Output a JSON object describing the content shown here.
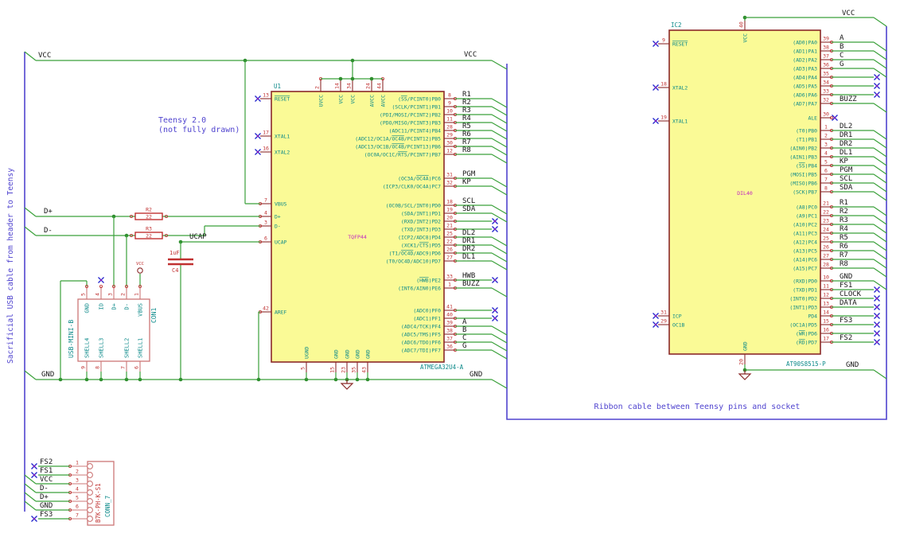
{
  "notes": {
    "sacrificial_cable": "Sacrificial USB cable from header to Teensy",
    "teensy_title": "Teensy 2.0",
    "teensy_subtitle": "(not fully drawn)",
    "ribbon_cable": "Ribbon cable between Teensy pins and socket"
  },
  "power": {
    "vcc": "VCC",
    "gnd": "GND",
    "d_plus": "D+",
    "d_minus": "D-",
    "ucap": "UCAP",
    "vcc_symbol": "VCC"
  },
  "u1": {
    "ref": "U1",
    "value": "ATMEGA32U4-A",
    "footprint": "TQFP44",
    "left_pins": [
      {
        "num": "13",
        "name": "~RESET~",
        "term": "x"
      },
      {
        "num": "17",
        "name": "XTAL1",
        "term": "x"
      },
      {
        "num": "16",
        "name": "XTAL2",
        "term": "x"
      },
      {
        "num": "7",
        "name": "VBUS",
        "term": "wire"
      },
      {
        "num": "4",
        "name": "D+",
        "term": "wire"
      },
      {
        "num": "3",
        "name": "D-",
        "term": "wire"
      },
      {
        "num": "6",
        "name": "UCAP",
        "term": "wire"
      },
      {
        "num": "42",
        "name": "AREF",
        "term": "wire"
      }
    ],
    "right_pins": [
      {
        "num": "8",
        "name": "(~SS~/PCINT0)PB0",
        "label": "R1",
        "term": "bus"
      },
      {
        "num": "9",
        "name": "(SCLK/PCINT1)PB1",
        "label": "R2",
        "term": "bus"
      },
      {
        "num": "10",
        "name": "(PDI/MOSI/PCINT2)PB2",
        "label": "R3",
        "term": "bus"
      },
      {
        "num": "11",
        "name": "(PDO/MISO/PCINT3)PB3",
        "label": "R4",
        "term": "bus"
      },
      {
        "num": "28",
        "name": "(ADC11/PCINT4)PB4",
        "label": "R5",
        "term": "bus"
      },
      {
        "num": "29",
        "name": "(ADC12/OC1A/~OC4B~/PCINT12)PB5",
        "label": "R6",
        "term": "bus"
      },
      {
        "num": "30",
        "name": "(ADC13/OC1B/~OC4B~/PCINT13)PB6",
        "label": "R7",
        "term": "bus"
      },
      {
        "num": "12",
        "name": "(OC0A/OC1C/~RTS~/PCINT7)PB7",
        "label": "R8",
        "term": "bus"
      },
      {
        "num": "31",
        "name": "(OC3A/~OC4A~)PC6",
        "label": "PGM",
        "term": "bus"
      },
      {
        "num": "32",
        "name": "(ICP3/CLK0/OC4A)PC7",
        "label": "KP",
        "term": "bus"
      },
      {
        "num": "18",
        "name": "(OC0B/SCL/INT0)PD0",
        "label": "SCL",
        "term": "bus"
      },
      {
        "num": "19",
        "name": "(SDA/INT1)PD1",
        "label": "SDA",
        "term": "bus"
      },
      {
        "num": "20",
        "name": "(RXD/INT2)PD2",
        "label": "",
        "term": "x"
      },
      {
        "num": "21",
        "name": "(TXD/INT3)PD3",
        "label": "",
        "term": "x"
      },
      {
        "num": "25",
        "name": "(ICP2/ADC8)PD4",
        "label": "DL2",
        "term": "bus"
      },
      {
        "num": "22",
        "name": "(XCK1/~CTS~)PD5",
        "label": "DR1",
        "term": "bus"
      },
      {
        "num": "26",
        "name": "(T1/~OC4D~/ADC9)PD6",
        "label": "DR2",
        "term": "bus"
      },
      {
        "num": "27",
        "name": "(T0/OC4D/ADC10)PD7",
        "label": "DL1",
        "term": "bus"
      },
      {
        "num": "33",
        "name": "(~HWB~)PE2",
        "label": "HWB",
        "term": "x"
      },
      {
        "num": "1",
        "name": "(INT6/AIN0)PE6",
        "label": "BUZZ",
        "term": "bus"
      },
      {
        "num": "41",
        "name": "(ADC0)PF0",
        "label": "",
        "term": "x"
      },
      {
        "num": "40",
        "name": "(ADC1)PF1",
        "label": "",
        "term": "x"
      },
      {
        "num": "39",
        "name": "(ADC4/TCK)PF4",
        "label": "A",
        "term": "bus"
      },
      {
        "num": "38",
        "name": "(ADC5/TMS)PF5",
        "label": "B",
        "term": "bus"
      },
      {
        "num": "37",
        "name": "(ADC6/TDO)PF6",
        "label": "C",
        "term": "bus"
      },
      {
        "num": "36",
        "name": "(ADC7/TDI)PF7",
        "label": "G",
        "term": "bus"
      }
    ],
    "top_pins": [
      {
        "num": "2",
        "name": "UVCC"
      },
      {
        "num": "14",
        "name": "VCC"
      },
      {
        "num": "34",
        "name": "VCC"
      },
      {
        "num": "24",
        "name": "AVCC"
      },
      {
        "num": "44",
        "name": "AVCC"
      }
    ],
    "bottom_pins": [
      {
        "num": "5",
        "name": "UGND"
      },
      {
        "num": "15",
        "name": "GND"
      },
      {
        "num": "23",
        "name": "GND"
      },
      {
        "num": "35",
        "name": "GND"
      },
      {
        "num": "43",
        "name": "GND"
      }
    ]
  },
  "ic2": {
    "ref": "IC2",
    "value": "AT90S8515-P",
    "footprint": "DIL40",
    "left_pins": [
      {
        "num": "9",
        "name": "~RESET~",
        "term": "x"
      },
      {
        "num": "18",
        "name": "XTAL2",
        "term": "x"
      },
      {
        "num": "19",
        "name": "XTAL1",
        "term": "x"
      },
      {
        "num": "31",
        "name": "ICP",
        "term": "x"
      },
      {
        "num": "29",
        "name": "OC1B",
        "term": "x"
      }
    ],
    "right_pins": [
      {
        "num": "39",
        "name": "(AD0)PA0",
        "label": "A",
        "term": "bus"
      },
      {
        "num": "38",
        "name": "(AD1)PA1",
        "label": "B",
        "term": "bus"
      },
      {
        "num": "37",
        "name": "(AD2)PA2",
        "label": "C",
        "term": "bus"
      },
      {
        "num": "36",
        "name": "(AD3)PA3",
        "label": "G",
        "term": "bus"
      },
      {
        "num": "35",
        "name": "(AD4)PA4",
        "label": "",
        "term": "x"
      },
      {
        "num": "34",
        "name": "(AD5)PA5",
        "label": "",
        "term": "x"
      },
      {
        "num": "33",
        "name": "(AD6)PA6",
        "label": "",
        "term": "x"
      },
      {
        "num": "32",
        "name": "(AD7)PA7",
        "label": "BUZZ",
        "term": "bus"
      },
      {
        "num": "30",
        "name": "ALE",
        "label": "",
        "term": "x_stub"
      },
      {
        "num": "1",
        "name": "(T0)PB0",
        "label": "DL2",
        "term": "bus"
      },
      {
        "num": "2",
        "name": "(T1)PB1",
        "label": "DR1",
        "term": "bus"
      },
      {
        "num": "3",
        "name": "(AIN0)PB2",
        "label": "DR2",
        "term": "bus"
      },
      {
        "num": "4",
        "name": "(AIN1)PB3",
        "label": "DL1",
        "term": "bus"
      },
      {
        "num": "5",
        "name": "(~SS~)PB4",
        "label": "KP",
        "term": "bus"
      },
      {
        "num": "6",
        "name": "(MOSI)PB5",
        "label": "PGM",
        "term": "bus"
      },
      {
        "num": "7",
        "name": "(MISO)PB6",
        "label": "SCL",
        "term": "bus"
      },
      {
        "num": "8",
        "name": "(SCK)PB7",
        "label": "SDA",
        "term": "bus"
      },
      {
        "num": "21",
        "name": "(A8)PC0",
        "label": "R1",
        "term": "bus"
      },
      {
        "num": "22",
        "name": "(A9)PC1",
        "label": "R2",
        "term": "bus"
      },
      {
        "num": "23",
        "name": "(A10)PC2",
        "label": "R3",
        "term": "bus"
      },
      {
        "num": "24",
        "name": "(A11)PC3",
        "label": "R4",
        "term": "bus"
      },
      {
        "num": "25",
        "name": "(A12)PC4",
        "label": "R5",
        "term": "bus"
      },
      {
        "num": "26",
        "name": "(A13)PC5",
        "label": "R6",
        "term": "bus"
      },
      {
        "num": "27",
        "name": "(A14)PC6",
        "label": "R7",
        "term": "bus"
      },
      {
        "num": "28",
        "name": "(A15)PC7",
        "label": "R8",
        "term": "bus"
      },
      {
        "num": "10",
        "name": "(RXD)PD0",
        "label": "GND",
        "term": "bus"
      },
      {
        "num": "11",
        "name": "(TXD)PD1",
        "label": "FS1",
        "term": "x"
      },
      {
        "num": "12",
        "name": "(INT0)PD2",
        "label": "CLOCK",
        "term": "x"
      },
      {
        "num": "13",
        "name": "(INT1)PD3",
        "label": "DATA",
        "term": "x"
      },
      {
        "num": "14",
        "name": "PD4",
        "label": "",
        "term": "x"
      },
      {
        "num": "15",
        "name": "(OC1A)PD5",
        "label": "FS3",
        "term": "x"
      },
      {
        "num": "16",
        "name": "(~WR~)PD6",
        "label": "",
        "term": "x"
      },
      {
        "num": "17",
        "name": "(~RD~)PD7",
        "label": "FS2",
        "term": "x"
      }
    ],
    "top_pins": [
      {
        "num": "40",
        "name": "VCC"
      }
    ],
    "bottom_pins": [
      {
        "num": "20",
        "name": "GND"
      }
    ]
  },
  "con1": {
    "ref": "CON1",
    "value": "USB-MINI-B",
    "top_pins": [
      {
        "num": "5",
        "name": "GND"
      },
      {
        "num": "4",
        "name": "ID"
      },
      {
        "num": "3",
        "name": "D+"
      },
      {
        "num": "2",
        "name": "D-"
      },
      {
        "num": "1",
        "name": "VBUS"
      }
    ],
    "bottom_pins": [
      {
        "num": "9",
        "name": "SHELL4"
      },
      {
        "num": "8",
        "name": "SHELL3"
      },
      {
        "num": "7",
        "name": "SHELL2"
      },
      {
        "num": "6",
        "name": "SHELL1"
      }
    ]
  },
  "conn7": {
    "ref": "CONN_7",
    "value": "B7K-PH-K-S1",
    "pins": [
      {
        "num": "1",
        "label": "FS2",
        "term": "x"
      },
      {
        "num": "2",
        "label": "FS1",
        "term": "x"
      },
      {
        "num": "3",
        "label": "VCC",
        "term": "bus"
      },
      {
        "num": "4",
        "label": "D-",
        "term": "bus"
      },
      {
        "num": "5",
        "label": "D+",
        "term": "bus"
      },
      {
        "num": "6",
        "label": "GND",
        "term": "bus"
      },
      {
        "num": "7",
        "label": "FS3",
        "term": "x"
      }
    ]
  },
  "r2": {
    "ref": "R2",
    "value": "22"
  },
  "r3": {
    "ref": "R3",
    "value": "22"
  },
  "c4": {
    "ref": "C4",
    "value": "1uF"
  },
  "colors": {
    "wire": "#3ba13b",
    "junction": "#2f8f2f",
    "component": "#8b2929",
    "component_fill": "#fafa96",
    "connector_outline": "#cc7777",
    "pin_number": "#bf3030",
    "pin_name": "#0b8989",
    "net_label": "#161616",
    "note": "#5044cf",
    "noconnect": "#2424cd",
    "noconnect_dot": "#b013b0",
    "footprint": "#c026c0",
    "value_red": "#c03030"
  }
}
